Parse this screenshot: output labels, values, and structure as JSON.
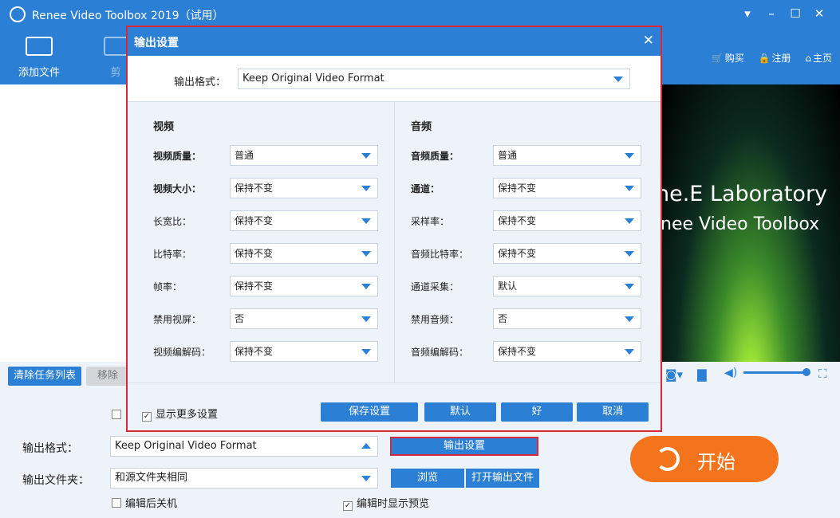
{
  "app": {
    "title": "Renee Video Toolbox 2019（试用）"
  },
  "toolbar": {
    "add_file": "添加文件",
    "cut": "剪"
  },
  "toplinks": {
    "buy": "购买",
    "register": "注册",
    "home": "主页"
  },
  "preview": {
    "line1": "ne.E Laboratory",
    "line2": "nee Video Toolbox"
  },
  "tasks": {
    "clear": "清除任务列表",
    "remove": "移除"
  },
  "bottom": {
    "format_label": "输出格式：",
    "format_value": "Keep Original Video Format",
    "output_settings": "输出设置",
    "folder_label": "输出文件夹：",
    "folder_value": "和源文件夹相同",
    "browse": "浏览",
    "open_folder": "打开输出文件",
    "shutdown_after": "编辑后关机",
    "show_preview": "编辑时显示预览",
    "start": "开始"
  },
  "dialog": {
    "title": "输出设置",
    "format_label": "输出格式：",
    "format_value": "Keep Original Video Format",
    "video": {
      "heading": "视频",
      "fields": [
        {
          "label": "视频质量：",
          "value": "普通",
          "bold": true
        },
        {
          "label": "视频大小：",
          "value": "保持不变",
          "bold": true
        },
        {
          "label": "长宽比：",
          "value": "保持不变",
          "bold": false
        },
        {
          "label": "比特率：",
          "value": "保持不变",
          "bold": false
        },
        {
          "label": "帧率：",
          "value": "保持不变",
          "bold": false
        },
        {
          "label": "禁用视屏：",
          "value": "否",
          "bold": false
        },
        {
          "label": "视频编解码：",
          "value": "保持不变",
          "bold": false
        }
      ]
    },
    "audio": {
      "heading": "音频",
      "fields": [
        {
          "label": "音频质量：",
          "value": "普通",
          "bold": true
        },
        {
          "label": "通道：",
          "value": "保持不变",
          "bold": true
        },
        {
          "label": "采样率：",
          "value": "保持不变",
          "bold": false
        },
        {
          "label": "音频比特率：",
          "value": "保持不变",
          "bold": false
        },
        {
          "label": "通道采集：",
          "value": "默认",
          "bold": false
        },
        {
          "label": "禁用音频：",
          "value": "否",
          "bold": false
        },
        {
          "label": "音频编解码：",
          "value": "保持不变",
          "bold": false
        }
      ]
    },
    "show_more": "显示更多设置",
    "save": "保存设置",
    "default": "默认",
    "ok": "好",
    "cancel": "取消"
  },
  "colors": {
    "accent": "#2b7fd4",
    "start": "#f3741d",
    "highlight": "#d9283a"
  }
}
